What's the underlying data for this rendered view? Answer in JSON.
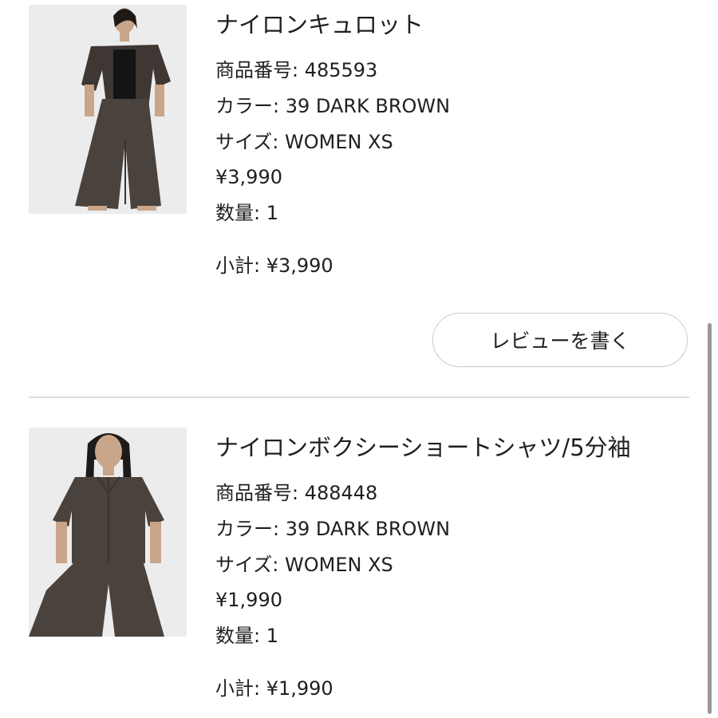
{
  "items": [
    {
      "name": "ナイロンキュロット",
      "product_number": "商品番号: 485593",
      "color": "カラー: 39 DARK BROWN",
      "size": "サイズ: WOMEN XS",
      "price": "¥3,990",
      "quantity": "数量: 1",
      "subtotal": "小計: ¥3,990",
      "review_button": "レビューを書く"
    },
    {
      "name": "ナイロンボクシーショートシャツ/5分袖",
      "product_number": "商品番号: 488448",
      "color": "カラー: 39 DARK BROWN",
      "size": "サイズ: WOMEN XS",
      "price": "¥1,990",
      "quantity": "数量: 1",
      "subtotal": "小計: ¥1,990"
    }
  ],
  "colors": {
    "text": "#1f1f1f",
    "divider": "#dcdcdc",
    "button_border": "#cfcfcf",
    "garment": "#4a423d"
  }
}
